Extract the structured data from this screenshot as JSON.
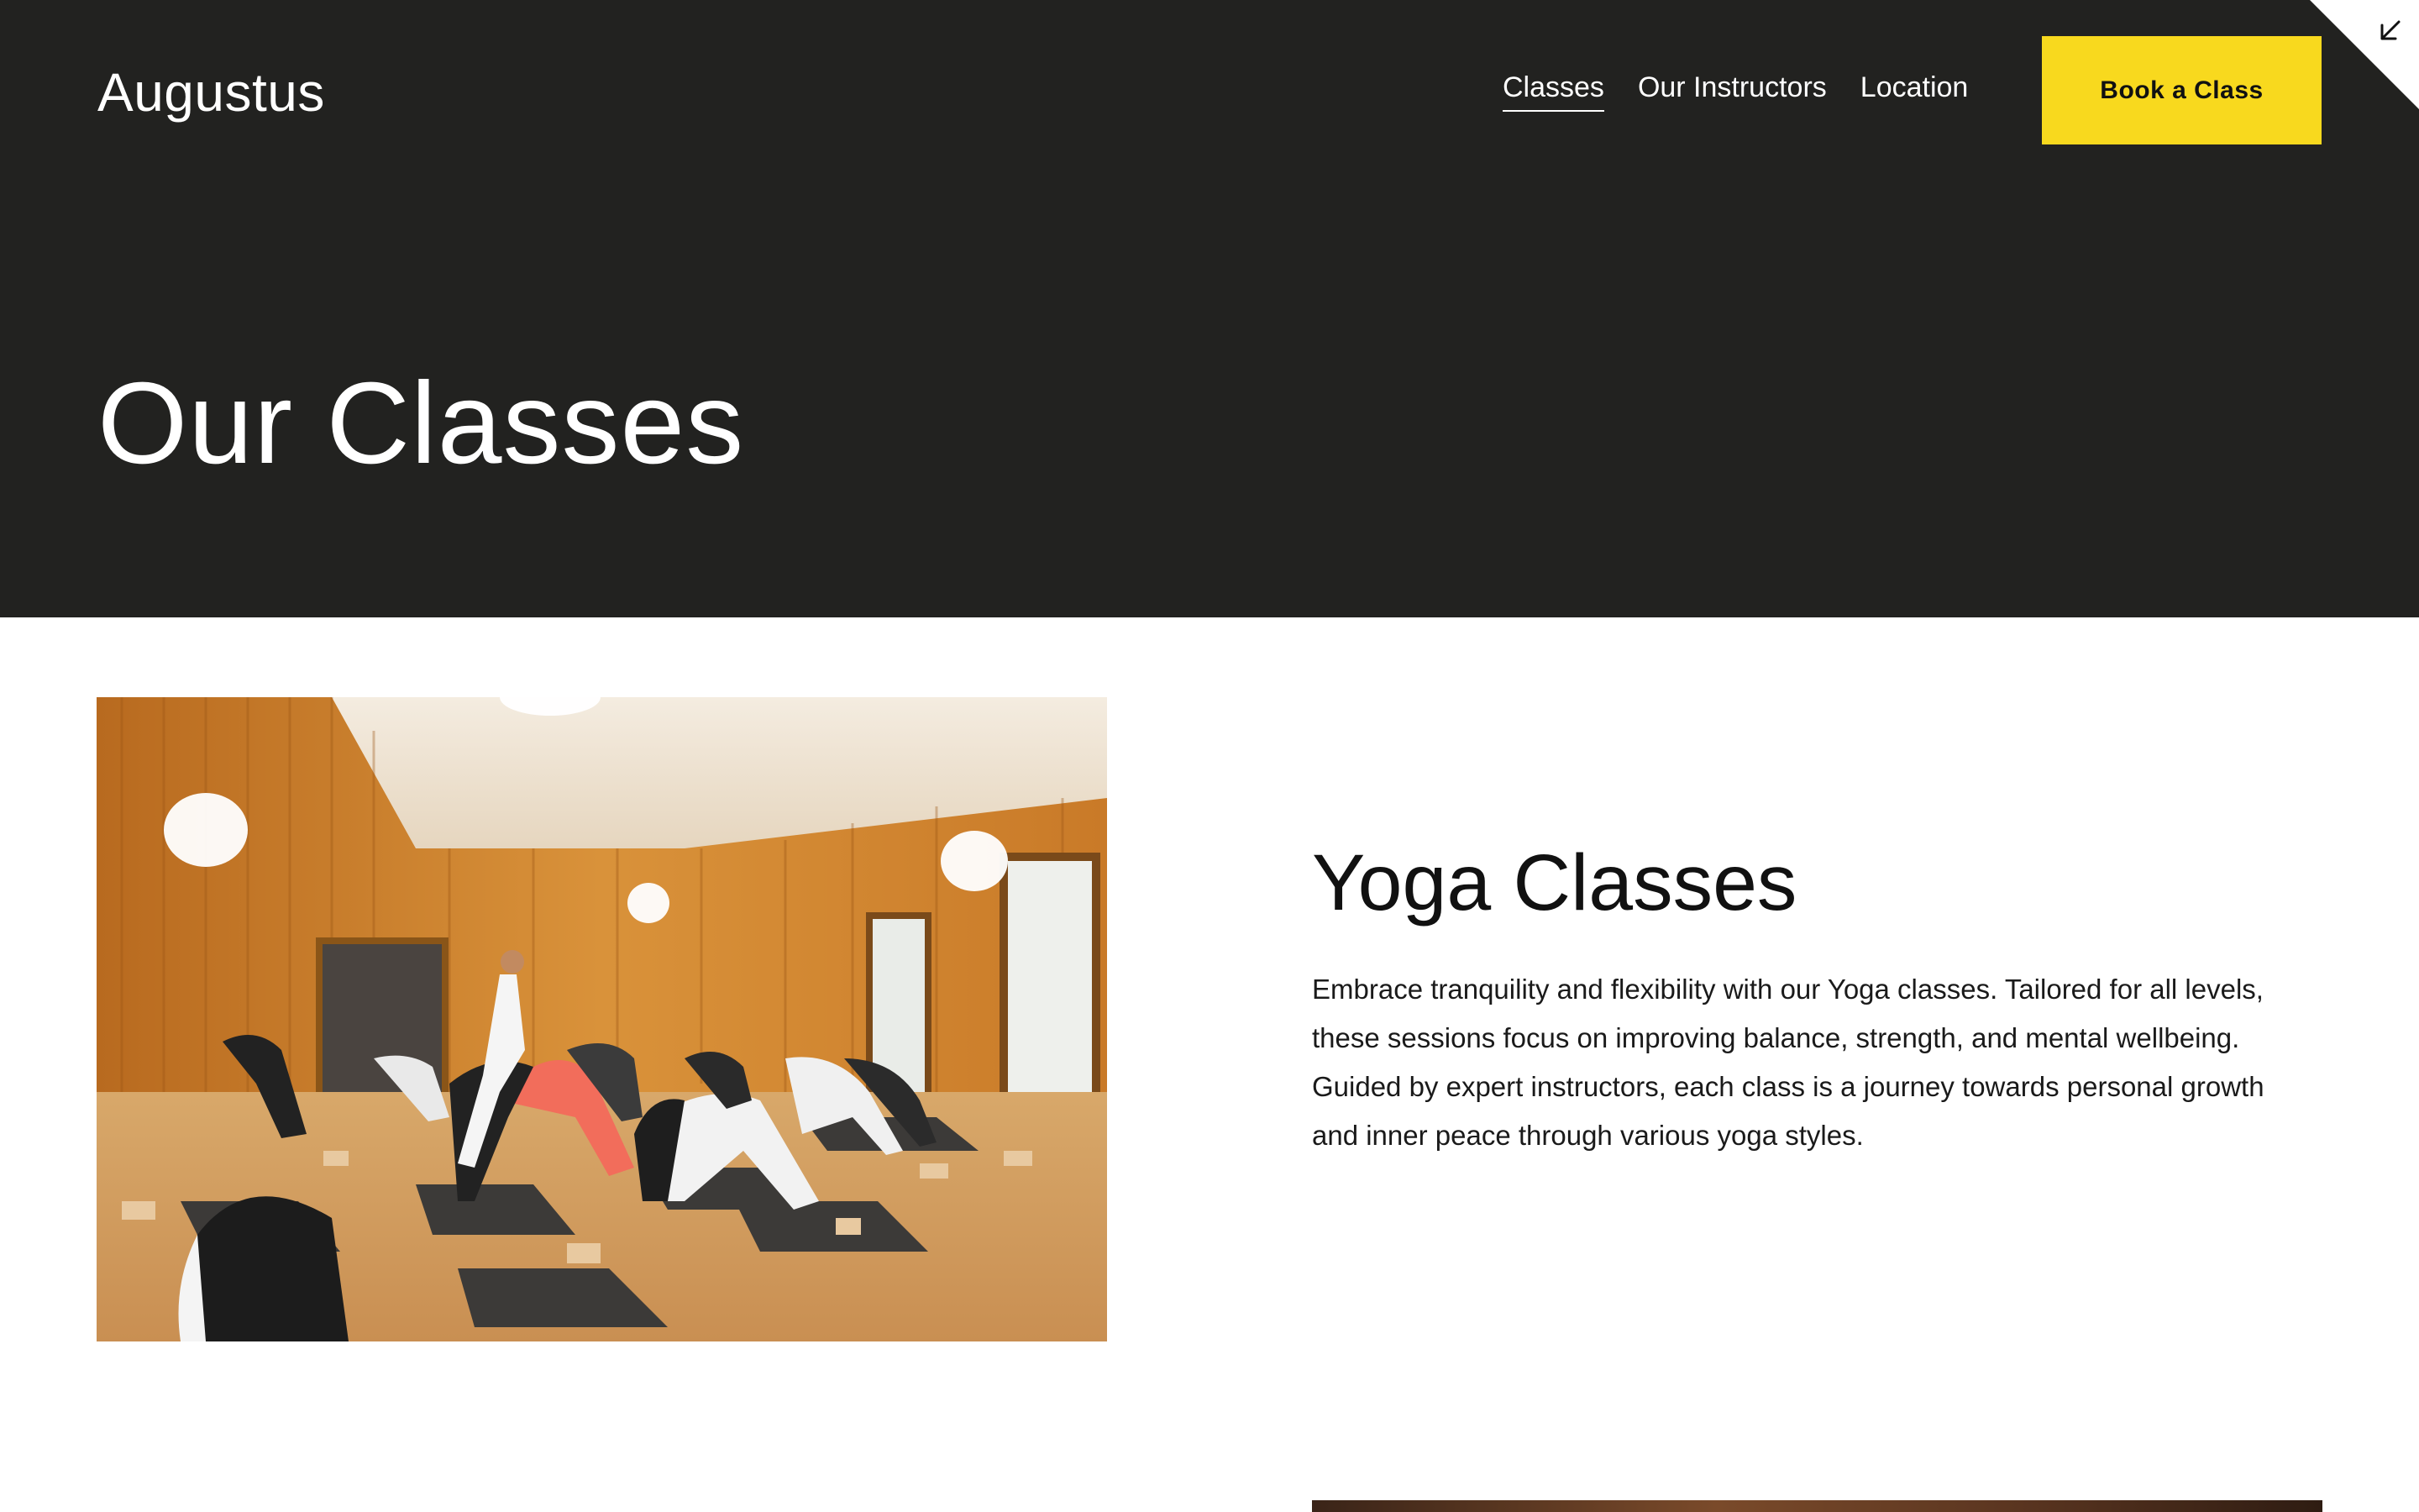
{
  "header": {
    "brand": "Augustus",
    "nav": [
      {
        "label": "Classes",
        "active": true
      },
      {
        "label": "Our Instructors",
        "active": false
      },
      {
        "label": "Location",
        "active": false
      }
    ],
    "cta_label": "Book a Class"
  },
  "hero": {
    "title": "Our Classes"
  },
  "sections": [
    {
      "title": "Yoga Classes",
      "body": "Embrace tranquility and flexibility with our Yoga classes. Tailored for all levels, these sessions focus on improving balance, strength, and mental wellbeing. Guided by expert instructors, each class is a journey towards personal growth and inner peace through various yoga styles."
    }
  ],
  "colors": {
    "hero_bg": "#222220",
    "accent": "#f8d91e",
    "text_dark": "#111111"
  },
  "icons": {
    "corner": "arrow-down-left-icon"
  }
}
